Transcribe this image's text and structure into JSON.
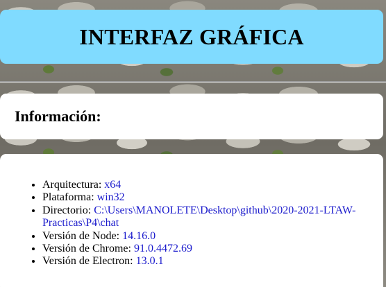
{
  "header": {
    "title": "INTERFAZ GRÁFICA"
  },
  "info": {
    "heading": "Información:"
  },
  "details": {
    "items": [
      {
        "label": "Arquitectura: ",
        "value": "x64"
      },
      {
        "label": "Plataforma: ",
        "value": "win32"
      },
      {
        "label": "Directorio: ",
        "value": "C:\\Users\\MANOLETE\\Desktop\\github\\2020-2021-LTAW-Practicas\\P4\\chat"
      },
      {
        "label": "Versión de Node: ",
        "value": "14.16.0"
      },
      {
        "label": "Versión de Chrome: ",
        "value": "91.0.4472.69"
      },
      {
        "label": "Versión de Electron: ",
        "value": "13.0.1"
      }
    ]
  },
  "colors": {
    "header_bg": "#80dbff",
    "value_text": "#1a1acc",
    "card_bg": "#ffffff"
  }
}
